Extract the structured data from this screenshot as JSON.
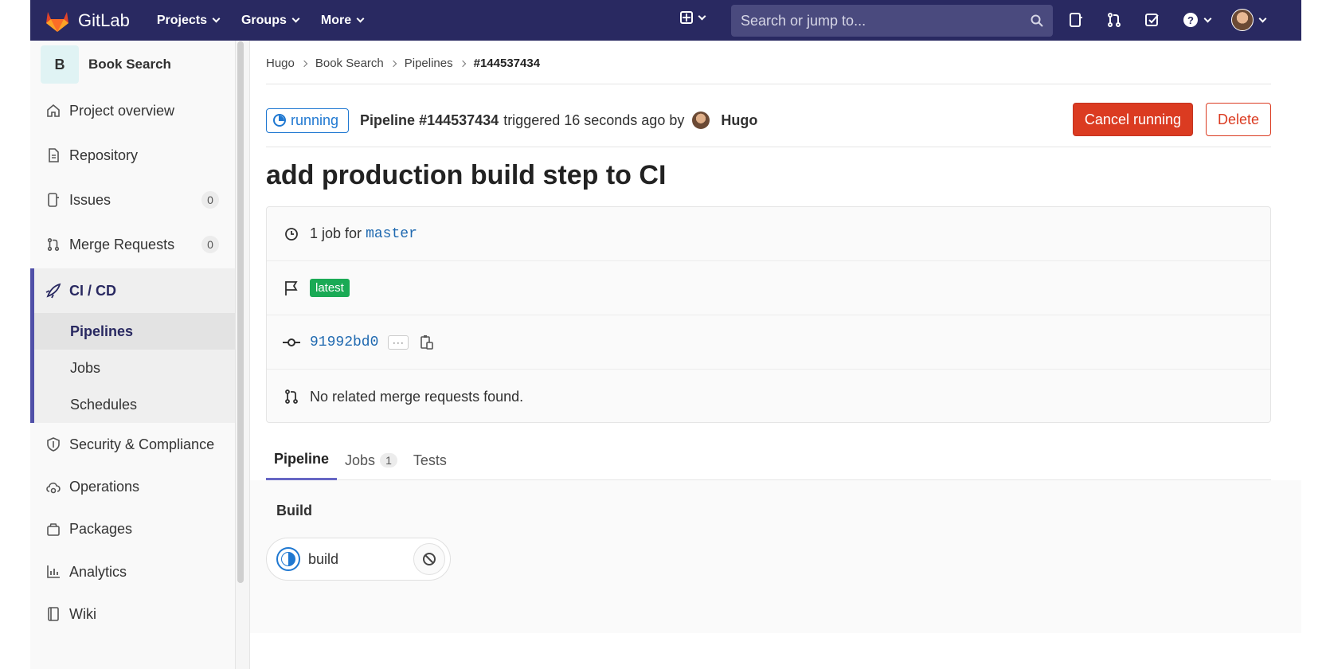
{
  "navbar": {
    "brand": "GitLab",
    "menu": [
      {
        "label": "Projects"
      },
      {
        "label": "Groups"
      },
      {
        "label": "More"
      }
    ],
    "search_placeholder": "Search or jump to..."
  },
  "sidebar": {
    "project_initial": "B",
    "project_name": "Book Search",
    "items": [
      {
        "label": "Project overview",
        "icon": "home-icon"
      },
      {
        "label": "Repository",
        "icon": "document-icon"
      },
      {
        "label": "Issues",
        "icon": "issues-icon",
        "count": "0"
      },
      {
        "label": "Merge Requests",
        "icon": "merge-request-icon",
        "count": "0"
      }
    ],
    "cicd": {
      "label": "CI / CD",
      "icon": "rocket-icon",
      "sub_items": [
        {
          "label": "Pipelines",
          "active": true
        },
        {
          "label": "Jobs"
        },
        {
          "label": "Schedules"
        }
      ]
    },
    "items_after": [
      {
        "label": "Security & Compliance",
        "icon": "shield-icon"
      },
      {
        "label": "Operations",
        "icon": "cloud-gear-icon"
      },
      {
        "label": "Packages",
        "icon": "package-icon"
      },
      {
        "label": "Analytics",
        "icon": "chart-icon"
      },
      {
        "label": "Wiki",
        "icon": "book-icon"
      }
    ]
  },
  "breadcrumb": [
    "Hugo",
    "Book Search",
    "Pipelines",
    "#144537434"
  ],
  "pipeline": {
    "status": "running",
    "title": "Pipeline #144537434",
    "triggered_text": "triggered 16 seconds ago by",
    "user": "Hugo",
    "cancel_label": "Cancel running",
    "delete_label": "Delete",
    "commit_title": "add production build step to CI",
    "jobs_prefix": "1 job for",
    "branch": "master",
    "tag": "latest",
    "sha": "91992bd0",
    "ellipsis": "···",
    "merge_requests_text": "No related merge requests found."
  },
  "tabs": [
    {
      "label": "Pipeline",
      "active": true
    },
    {
      "label": "Jobs",
      "count": "1"
    },
    {
      "label": "Tests"
    }
  ],
  "graph": {
    "stage": "Build",
    "job": "build"
  },
  "colors": {
    "navbar": "#292961",
    "running": "#1f78d1",
    "danger": "#db3b21",
    "latest_tag": "#1aaa55"
  }
}
